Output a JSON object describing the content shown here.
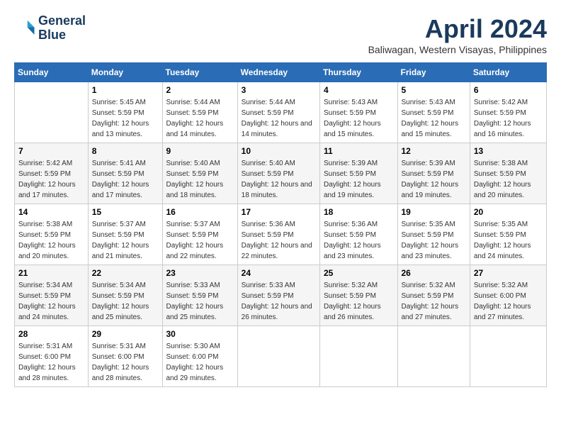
{
  "header": {
    "logo_line1": "General",
    "logo_line2": "Blue",
    "month": "April 2024",
    "location": "Baliwagan, Western Visayas, Philippines"
  },
  "days_of_week": [
    "Sunday",
    "Monday",
    "Tuesday",
    "Wednesday",
    "Thursday",
    "Friday",
    "Saturday"
  ],
  "weeks": [
    [
      {
        "day": "",
        "sunrise": "",
        "sunset": "",
        "daylight": ""
      },
      {
        "day": "1",
        "sunrise": "Sunrise: 5:45 AM",
        "sunset": "Sunset: 5:59 PM",
        "daylight": "Daylight: 12 hours and 13 minutes."
      },
      {
        "day": "2",
        "sunrise": "Sunrise: 5:44 AM",
        "sunset": "Sunset: 5:59 PM",
        "daylight": "Daylight: 12 hours and 14 minutes."
      },
      {
        "day": "3",
        "sunrise": "Sunrise: 5:44 AM",
        "sunset": "Sunset: 5:59 PM",
        "daylight": "Daylight: 12 hours and 14 minutes."
      },
      {
        "day": "4",
        "sunrise": "Sunrise: 5:43 AM",
        "sunset": "Sunset: 5:59 PM",
        "daylight": "Daylight: 12 hours and 15 minutes."
      },
      {
        "day": "5",
        "sunrise": "Sunrise: 5:43 AM",
        "sunset": "Sunset: 5:59 PM",
        "daylight": "Daylight: 12 hours and 15 minutes."
      },
      {
        "day": "6",
        "sunrise": "Sunrise: 5:42 AM",
        "sunset": "Sunset: 5:59 PM",
        "daylight": "Daylight: 12 hours and 16 minutes."
      }
    ],
    [
      {
        "day": "7",
        "sunrise": "Sunrise: 5:42 AM",
        "sunset": "Sunset: 5:59 PM",
        "daylight": "Daylight: 12 hours and 17 minutes."
      },
      {
        "day": "8",
        "sunrise": "Sunrise: 5:41 AM",
        "sunset": "Sunset: 5:59 PM",
        "daylight": "Daylight: 12 hours and 17 minutes."
      },
      {
        "day": "9",
        "sunrise": "Sunrise: 5:40 AM",
        "sunset": "Sunset: 5:59 PM",
        "daylight": "Daylight: 12 hours and 18 minutes."
      },
      {
        "day": "10",
        "sunrise": "Sunrise: 5:40 AM",
        "sunset": "Sunset: 5:59 PM",
        "daylight": "Daylight: 12 hours and 18 minutes."
      },
      {
        "day": "11",
        "sunrise": "Sunrise: 5:39 AM",
        "sunset": "Sunset: 5:59 PM",
        "daylight": "Daylight: 12 hours and 19 minutes."
      },
      {
        "day": "12",
        "sunrise": "Sunrise: 5:39 AM",
        "sunset": "Sunset: 5:59 PM",
        "daylight": "Daylight: 12 hours and 19 minutes."
      },
      {
        "day": "13",
        "sunrise": "Sunrise: 5:38 AM",
        "sunset": "Sunset: 5:59 PM",
        "daylight": "Daylight: 12 hours and 20 minutes."
      }
    ],
    [
      {
        "day": "14",
        "sunrise": "Sunrise: 5:38 AM",
        "sunset": "Sunset: 5:59 PM",
        "daylight": "Daylight: 12 hours and 20 minutes."
      },
      {
        "day": "15",
        "sunrise": "Sunrise: 5:37 AM",
        "sunset": "Sunset: 5:59 PM",
        "daylight": "Daylight: 12 hours and 21 minutes."
      },
      {
        "day": "16",
        "sunrise": "Sunrise: 5:37 AM",
        "sunset": "Sunset: 5:59 PM",
        "daylight": "Daylight: 12 hours and 22 minutes."
      },
      {
        "day": "17",
        "sunrise": "Sunrise: 5:36 AM",
        "sunset": "Sunset: 5:59 PM",
        "daylight": "Daylight: 12 hours and 22 minutes."
      },
      {
        "day": "18",
        "sunrise": "Sunrise: 5:36 AM",
        "sunset": "Sunset: 5:59 PM",
        "daylight": "Daylight: 12 hours and 23 minutes."
      },
      {
        "day": "19",
        "sunrise": "Sunrise: 5:35 AM",
        "sunset": "Sunset: 5:59 PM",
        "daylight": "Daylight: 12 hours and 23 minutes."
      },
      {
        "day": "20",
        "sunrise": "Sunrise: 5:35 AM",
        "sunset": "Sunset: 5:59 PM",
        "daylight": "Daylight: 12 hours and 24 minutes."
      }
    ],
    [
      {
        "day": "21",
        "sunrise": "Sunrise: 5:34 AM",
        "sunset": "Sunset: 5:59 PM",
        "daylight": "Daylight: 12 hours and 24 minutes."
      },
      {
        "day": "22",
        "sunrise": "Sunrise: 5:34 AM",
        "sunset": "Sunset: 5:59 PM",
        "daylight": "Daylight: 12 hours and 25 minutes."
      },
      {
        "day": "23",
        "sunrise": "Sunrise: 5:33 AM",
        "sunset": "Sunset: 5:59 PM",
        "daylight": "Daylight: 12 hours and 25 minutes."
      },
      {
        "day": "24",
        "sunrise": "Sunrise: 5:33 AM",
        "sunset": "Sunset: 5:59 PM",
        "daylight": "Daylight: 12 hours and 26 minutes."
      },
      {
        "day": "25",
        "sunrise": "Sunrise: 5:32 AM",
        "sunset": "Sunset: 5:59 PM",
        "daylight": "Daylight: 12 hours and 26 minutes."
      },
      {
        "day": "26",
        "sunrise": "Sunrise: 5:32 AM",
        "sunset": "Sunset: 5:59 PM",
        "daylight": "Daylight: 12 hours and 27 minutes."
      },
      {
        "day": "27",
        "sunrise": "Sunrise: 5:32 AM",
        "sunset": "Sunset: 6:00 PM",
        "daylight": "Daylight: 12 hours and 27 minutes."
      }
    ],
    [
      {
        "day": "28",
        "sunrise": "Sunrise: 5:31 AM",
        "sunset": "Sunset: 6:00 PM",
        "daylight": "Daylight: 12 hours and 28 minutes."
      },
      {
        "day": "29",
        "sunrise": "Sunrise: 5:31 AM",
        "sunset": "Sunset: 6:00 PM",
        "daylight": "Daylight: 12 hours and 28 minutes."
      },
      {
        "day": "30",
        "sunrise": "Sunrise: 5:30 AM",
        "sunset": "Sunset: 6:00 PM",
        "daylight": "Daylight: 12 hours and 29 minutes."
      },
      {
        "day": "",
        "sunrise": "",
        "sunset": "",
        "daylight": ""
      },
      {
        "day": "",
        "sunrise": "",
        "sunset": "",
        "daylight": ""
      },
      {
        "day": "",
        "sunrise": "",
        "sunset": "",
        "daylight": ""
      },
      {
        "day": "",
        "sunrise": "",
        "sunset": "",
        "daylight": ""
      }
    ]
  ]
}
